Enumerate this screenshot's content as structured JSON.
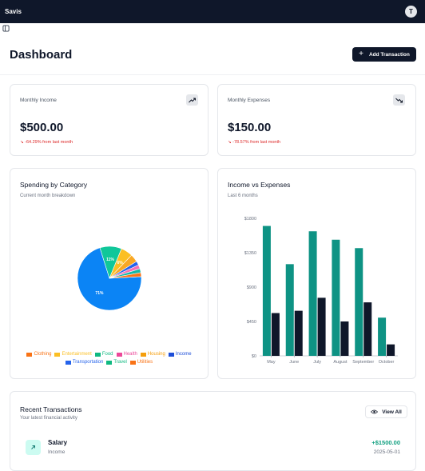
{
  "app": {
    "name": "Savis",
    "avatar_initial": "T"
  },
  "header": {
    "title": "Dashboard",
    "add_button_label": "Add Transaction"
  },
  "stats": [
    {
      "label": "Monthly Income",
      "value": "$500.00",
      "change": "-64.29% from last month",
      "trend_icon": "trending-up-icon"
    },
    {
      "label": "Monthly Expenses",
      "value": "$150.00",
      "change": "-78.57% from last month",
      "trend_icon": "trending-down-icon"
    }
  ],
  "spending": {
    "title": "Spending by Category",
    "subtitle": "Current month breakdown",
    "legend": [
      {
        "label": "Clothing",
        "color": "#f97316"
      },
      {
        "label": "Entertainment",
        "color": "#fbbf24"
      },
      {
        "label": "Food",
        "color": "#10b981"
      },
      {
        "label": "Health",
        "color": "#ec4899"
      },
      {
        "label": "Housing",
        "color": "#f59e0b"
      },
      {
        "label": "Income",
        "color": "#1d4ed8"
      },
      {
        "label": "Transportation",
        "color": "#2563eb"
      },
      {
        "label": "Travel",
        "color": "#10b981"
      },
      {
        "label": "Utilities",
        "color": "#f97316"
      }
    ]
  },
  "income_vs_expenses": {
    "title": "Income vs Expenses",
    "subtitle": "Last 6 months"
  },
  "recent": {
    "title": "Recent Transactions",
    "subtitle": "Your latest financial activity",
    "view_all_label": "View All",
    "transactions": [
      {
        "name": "Salary",
        "category": "Income",
        "amount": "+$1500.00",
        "date": "2025-05-01"
      }
    ]
  },
  "chart_data": [
    {
      "type": "pie",
      "title": "",
      "slices": [
        {
          "label": "Income",
          "value": 71,
          "color": "#0b84f5"
        },
        {
          "label": "Food",
          "value": 11,
          "color": "#10c79a"
        },
        {
          "label": "Entertainment",
          "value": 6,
          "color": "#fbbf24"
        },
        {
          "label": "Housing",
          "value": 4,
          "color": "#f9a825"
        },
        {
          "label": "Transportation",
          "value": 2,
          "color": "#2563eb"
        },
        {
          "label": "Health",
          "value": 2,
          "color": "#f472b6"
        },
        {
          "label": "Travel",
          "value": 2,
          "color": "#14b8a6"
        },
        {
          "label": "Clothing",
          "value": 2,
          "color": "#f97316"
        }
      ],
      "data_labels": [
        "71%",
        "11%",
        "6%"
      ]
    },
    {
      "type": "bar",
      "title": "",
      "categories": [
        "May",
        "June",
        "July",
        "August",
        "September",
        "October"
      ],
      "series": [
        {
          "name": "Income",
          "color": "#0e9384",
          "values": [
            1700,
            1200,
            1630,
            1520,
            1410,
            500
          ]
        },
        {
          "name": "Expenses",
          "color": "#0f172a",
          "values": [
            560,
            590,
            760,
            450,
            700,
            150
          ]
        }
      ],
      "ylim": [
        0,
        1800
      ],
      "yticks": [
        "$0",
        "$450",
        "$900",
        "$1350",
        "$1800"
      ],
      "ytick_values": [
        0,
        450,
        900,
        1350,
        1800
      ]
    }
  ]
}
